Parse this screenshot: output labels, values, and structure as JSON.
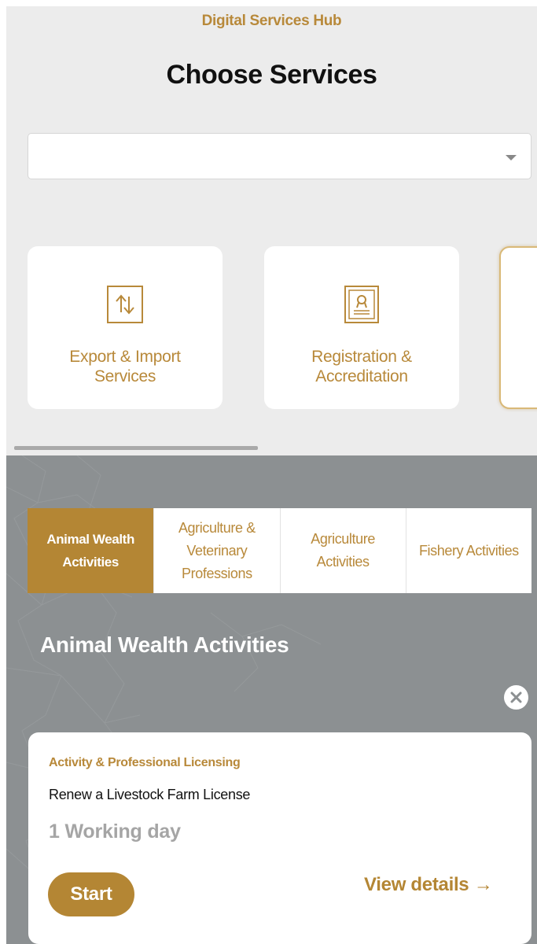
{
  "header": {
    "hub_title": "Digital Services Hub",
    "page_title": "Choose Services"
  },
  "service_select": {
    "value": "",
    "icon": "chevron-down-icon"
  },
  "categories": [
    {
      "label": "Export & Import Services",
      "icon": "export-import-icon"
    },
    {
      "label": "Registration & Accreditation",
      "icon": "certificate-icon"
    }
  ],
  "tabs": [
    {
      "label": "Animal Wealth Activities",
      "active": true
    },
    {
      "label": "Agriculture & Veterinary Professions",
      "active": false
    },
    {
      "label": "Agriculture Activities",
      "active": false
    },
    {
      "label": "Fishery Activities",
      "active": false
    }
  ],
  "section": {
    "title": "Animal Wealth Activities"
  },
  "service": {
    "category": "Activity & Professional Licensing",
    "name": "Renew a Livestock Farm License",
    "duration": "1 Working day",
    "start_label": "Start",
    "view_details_label": "View details →"
  },
  "colors": {
    "accent": "#b48634",
    "top_background": "#ececec",
    "bottom_background": "#8c9092"
  }
}
